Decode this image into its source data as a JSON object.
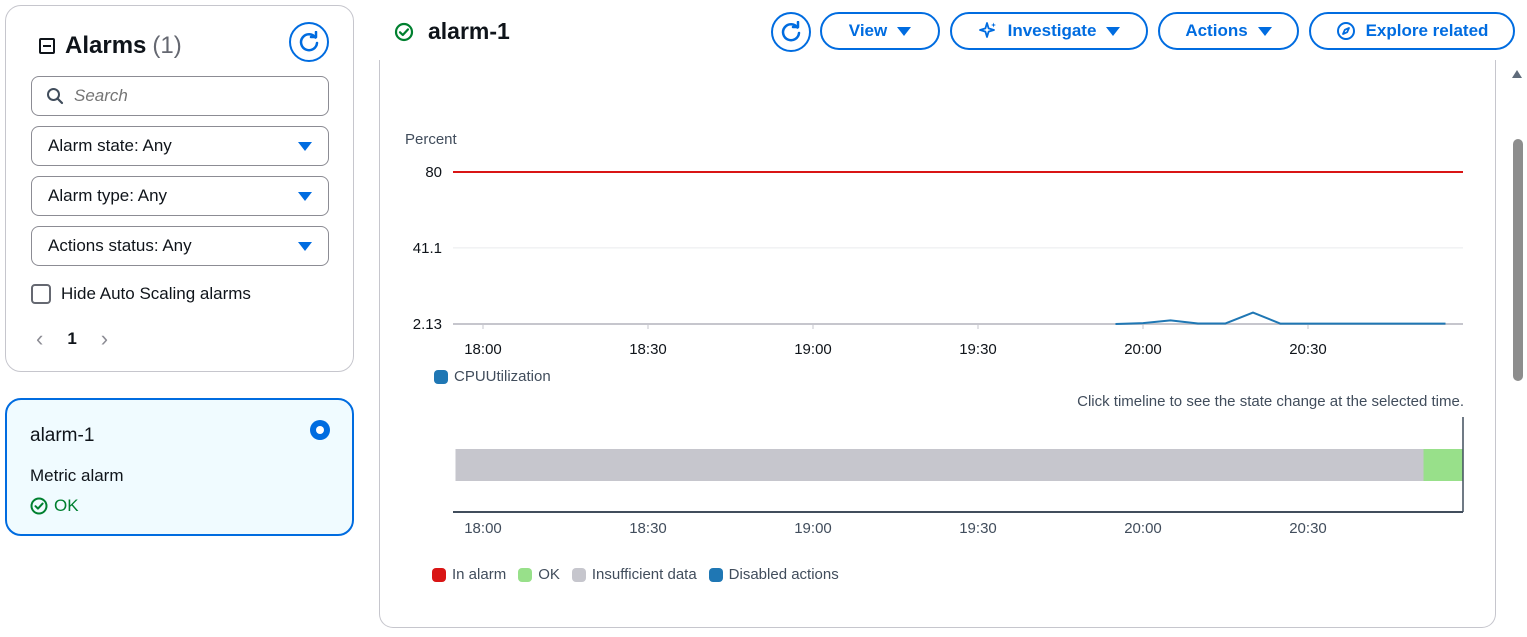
{
  "sidebar": {
    "title": "Alarms",
    "count": "(1)",
    "search_placeholder": "Search",
    "filters": {
      "alarm_state": "Alarm state: Any",
      "alarm_type": "Alarm type: Any",
      "actions_status": "Actions status: Any"
    },
    "hide_autoscaling_label": "Hide Auto Scaling alarms",
    "hide_autoscaling_checked": false,
    "current_page": "1"
  },
  "alarm_card": {
    "name": "alarm-1",
    "type": "Metric alarm",
    "status": "OK",
    "selected": true
  },
  "header": {
    "title": "alarm-1",
    "status_color": "#00802f",
    "buttons": {
      "view": "View",
      "investigate": "Investigate",
      "actions": "Actions",
      "explore": "Explore related"
    }
  },
  "colors": {
    "accent": "#006ce0",
    "threshold": "#d91515",
    "series": "#1f77b4",
    "ok": "#98e08a",
    "insufficient": "#c6c6cd",
    "in_alarm": "#d91515",
    "disabled_actions": "#1f77b4"
  },
  "chart_data": [
    {
      "type": "line",
      "ylabel": "Percent",
      "y_ticks": [
        "80",
        "41.1",
        "2.13"
      ],
      "ylim": [
        2.13,
        80
      ],
      "x_ticks": [
        "18:00",
        "18:30",
        "19:00",
        "19:30",
        "20:00",
        "20:30"
      ],
      "threshold": {
        "value": 80
      },
      "series": [
        {
          "name": "CPUUtilization",
          "x": [
            "19:55",
            "20:00",
            "20:05",
            "20:10",
            "20:15",
            "20:20",
            "20:25",
            "20:30",
            "20:35",
            "20:40",
            "20:45",
            "20:50",
            "20:55"
          ],
          "values": [
            2.13,
            2.6,
            4.0,
            2.4,
            2.4,
            8.0,
            2.3,
            2.3,
            2.3,
            2.3,
            2.3,
            2.3,
            2.3
          ]
        }
      ]
    },
    {
      "type": "timeline",
      "hint": "Click timeline to see the state change at the selected time.",
      "x_ticks": [
        "18:00",
        "18:30",
        "19:00",
        "19:30",
        "20:00",
        "20:30"
      ],
      "segments": [
        {
          "state": "Insufficient data",
          "start": "17:55",
          "end": "20:51"
        },
        {
          "state": "OK",
          "start": "20:51",
          "end": "20:59"
        }
      ],
      "legend": [
        "In alarm",
        "OK",
        "Insufficient data",
        "Disabled actions"
      ]
    }
  ]
}
